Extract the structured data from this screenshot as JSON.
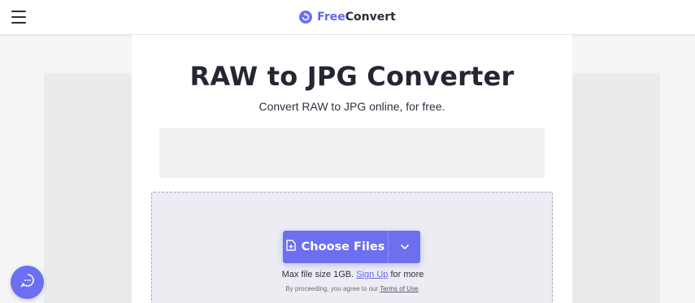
{
  "header": {
    "menu_icon": "hamburger-menu-icon",
    "logo_icon": "refresh-circle-icon",
    "logo_free": "Free",
    "logo_convert": "Convert"
  },
  "main": {
    "title": "RAW to JPG Converter",
    "subtitle": "Convert RAW to JPG online, for free."
  },
  "upload": {
    "choose_label": "Choose Files",
    "choose_icon": "file-add-icon",
    "dropdown_icon": "chevron-down-icon",
    "max_size_prefix": "Max file size 1GB.",
    "sign_up_link": "Sign Up",
    "max_size_suffix": "for more",
    "terms_prefix": "By proceeding, you agree to our",
    "terms_link": "Terms of Use",
    "terms_suffix": "."
  },
  "chat": {
    "icon": "chat-bubble-icon"
  },
  "colors": {
    "accent": "#6b6ff0",
    "brand": "#6366f1",
    "dropzone_bg": "#ececf2"
  }
}
